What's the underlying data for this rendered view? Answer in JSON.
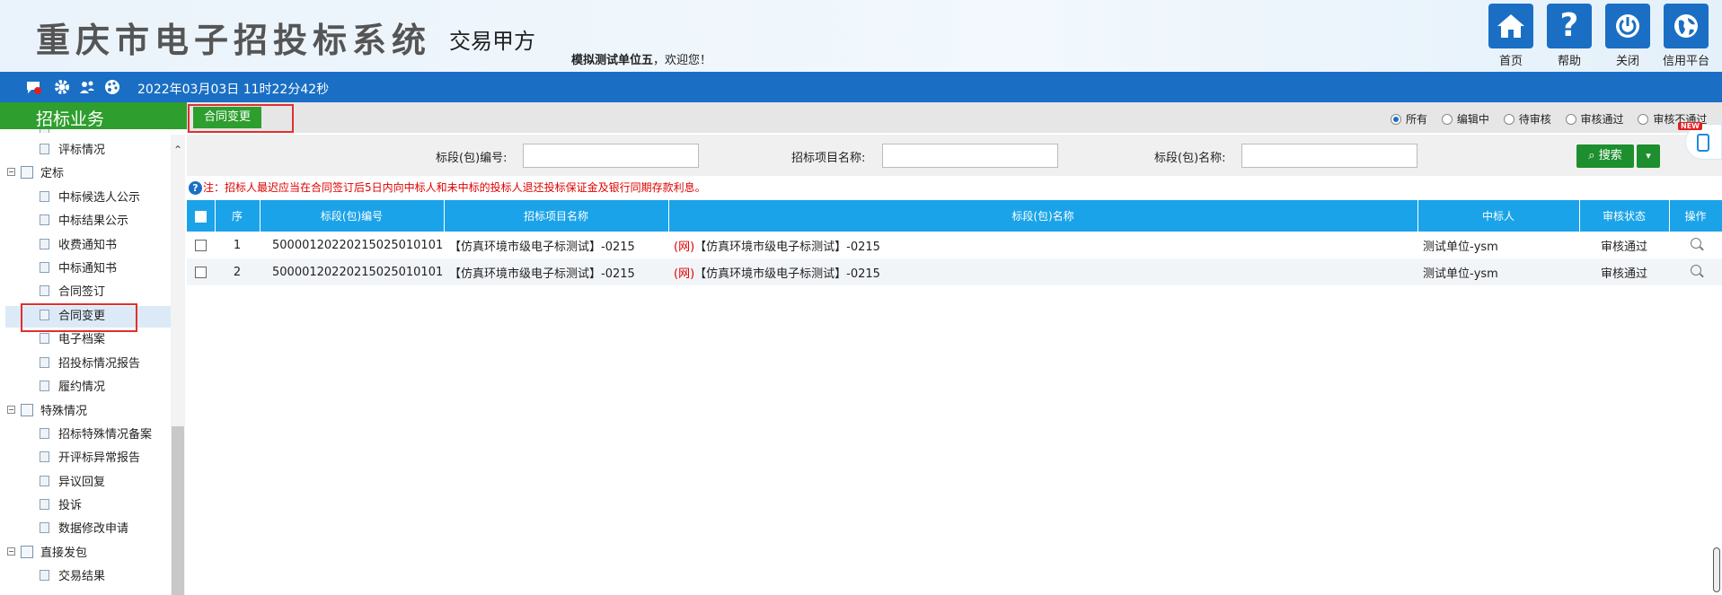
{
  "header": {
    "system_title": "重庆市电子招投标系统",
    "role": "交易甲方",
    "welcome_user": "模拟测试单位五",
    "welcome_suffix": "，欢迎您！",
    "buttons": [
      {
        "label": "首页",
        "icon": "home-icon"
      },
      {
        "label": "帮助",
        "icon": "help-icon"
      },
      {
        "label": "关闭",
        "icon": "power-icon"
      },
      {
        "label": "信用平台",
        "icon": "globe-icon"
      }
    ]
  },
  "bluebar": {
    "datetime": "2022年03月03日 11时22分42秒",
    "icons": [
      "message-icon",
      "gear-icon",
      "users-icon",
      "palette-icon"
    ]
  },
  "sidebar": {
    "title": "招标业务",
    "items": [
      {
        "label": "评标情况",
        "level": 2
      },
      {
        "label": "定标",
        "level": 1
      },
      {
        "label": "中标候选人公示",
        "level": 2
      },
      {
        "label": "中标结果公示",
        "level": 2
      },
      {
        "label": "收费通知书",
        "level": 2
      },
      {
        "label": "中标通知书",
        "level": 2
      },
      {
        "label": "合同签订",
        "level": 2
      },
      {
        "label": "合同变更",
        "level": 2,
        "active": true
      },
      {
        "label": "电子档案",
        "level": 2
      },
      {
        "label": "招投标情况报告",
        "level": 2
      },
      {
        "label": "履约情况",
        "level": 2
      },
      {
        "label": "特殊情况",
        "level": 1
      },
      {
        "label": "招标特殊情况备案",
        "level": 2
      },
      {
        "label": "开评标异常报告",
        "level": 2
      },
      {
        "label": "异议回复",
        "level": 2
      },
      {
        "label": "投诉",
        "level": 2
      },
      {
        "label": "数据修改申请",
        "level": 2
      },
      {
        "label": "直接发包",
        "level": 1
      },
      {
        "label": "交易结果",
        "level": 2
      }
    ]
  },
  "tab": {
    "label": "合同变更"
  },
  "filters": {
    "options": [
      "所有",
      "编辑中",
      "待审核",
      "审核通过",
      "审核不通过"
    ],
    "selected": "所有"
  },
  "search": {
    "fields": [
      {
        "label": "标段(包)编号:",
        "value": ""
      },
      {
        "label": "招标项目名称:",
        "value": ""
      },
      {
        "label": "标段(包)名称:",
        "value": ""
      }
    ],
    "button_label": "搜索"
  },
  "note": "注：招标人最迟应当在合同签订后5日内向中标人和未中标的投标人退还投标保证金及银行同期存款利息。",
  "float_badge": "NEW",
  "table": {
    "columns": [
      "序",
      "标段(包)编号",
      "招标项目名称",
      "标段(包)名称",
      "中标人",
      "审核状态",
      "操作"
    ],
    "rows": [
      {
        "no": "1",
        "code": "500001202202150250 10101",
        "project": "【仿真环境市级电子标测试】-0215",
        "tag": "(网)",
        "name": "【仿真环境市级电子标测试】-0215",
        "winner": "测试单位-ysm",
        "status": "审核通过"
      },
      {
        "no": "2",
        "code": "500001202202150250 10101",
        "project": "【仿真环境市级电子标测试】-0215",
        "tag": "(网)",
        "name": "【仿真环境市级电子标测试】-0215",
        "winner": "测试单位-ysm",
        "status": "审核通过"
      }
    ]
  }
}
